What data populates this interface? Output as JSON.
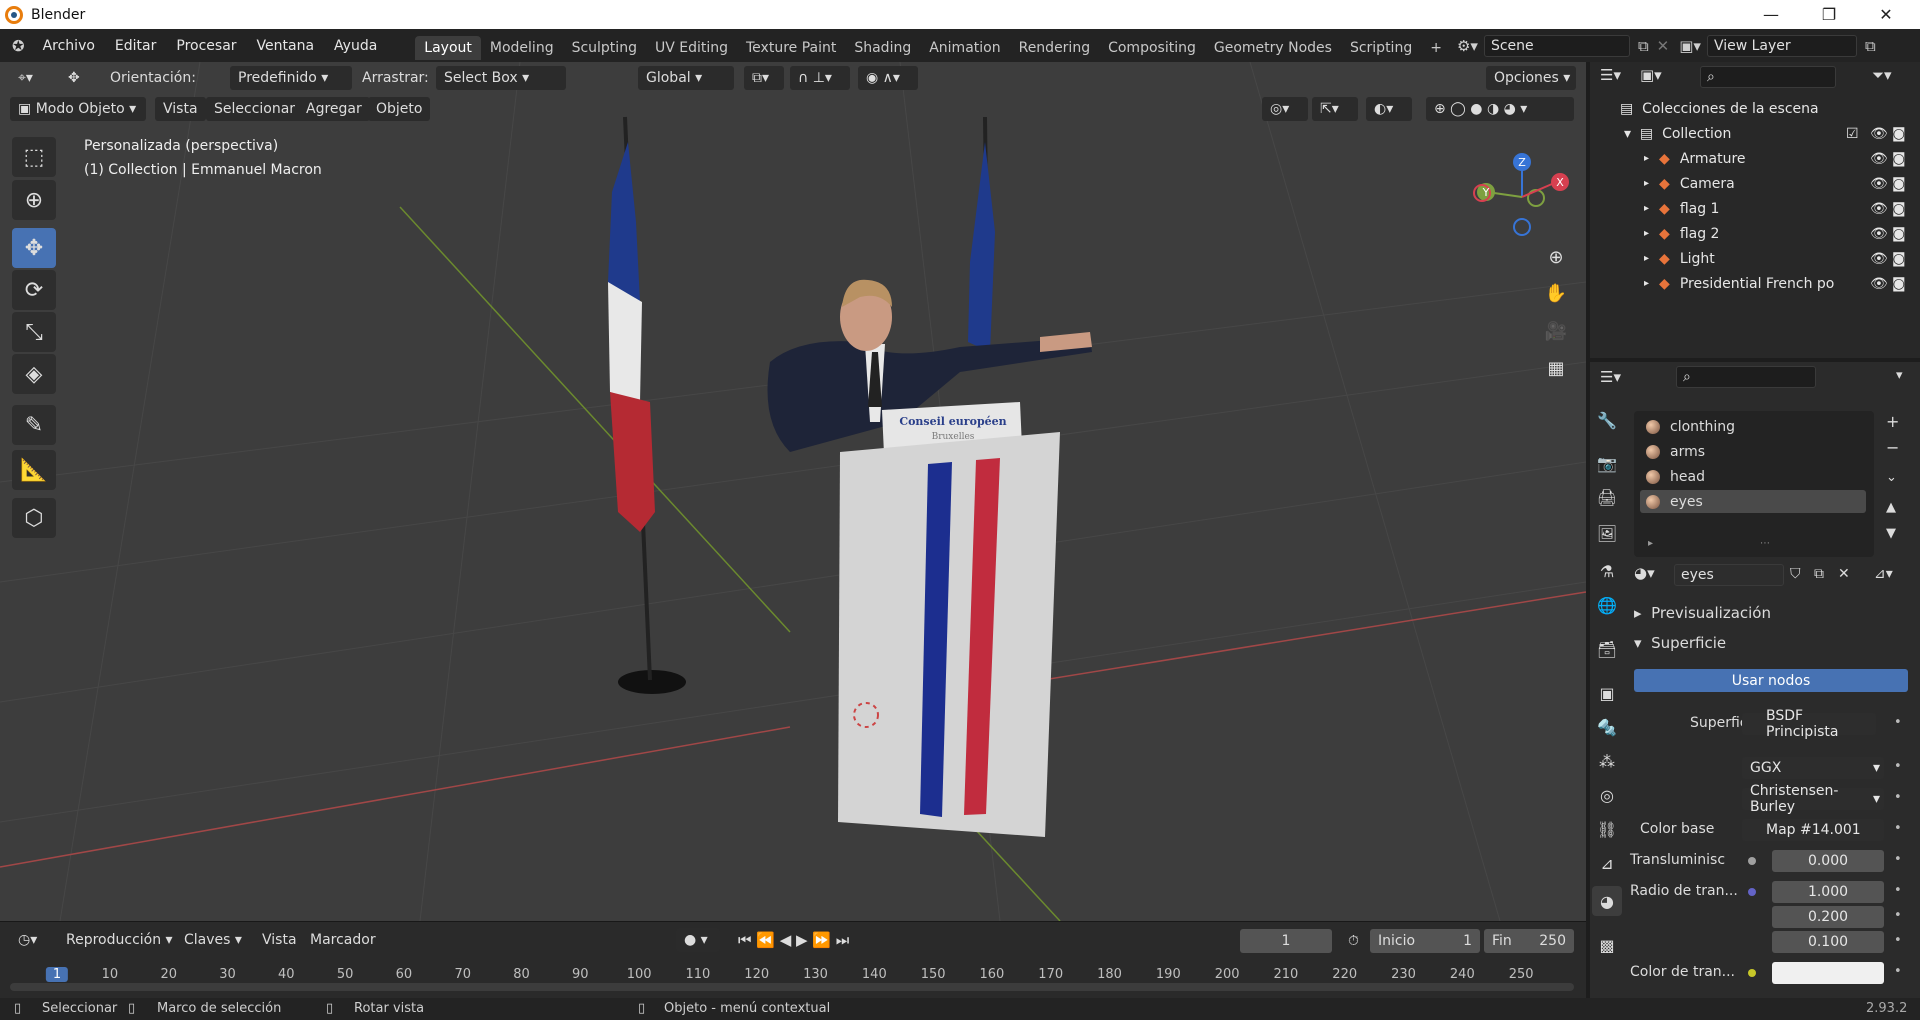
{
  "window": {
    "title": "Blender",
    "version": "2.93.2"
  },
  "menu": {
    "items": [
      "Archivo",
      "Editar",
      "Procesar",
      "Ventana",
      "Ayuda"
    ]
  },
  "workspaces": {
    "tabs": [
      "Layout",
      "Modeling",
      "Sculpting",
      "UV Editing",
      "Texture Paint",
      "Shading",
      "Animation",
      "Rendering",
      "Compositing",
      "Geometry Nodes",
      "Scripting"
    ],
    "active": "Layout"
  },
  "scene": {
    "name": "Scene",
    "view_layer": "View Layer"
  },
  "viewport_header": {
    "orientation_label": "Orientación:",
    "orientation_value": "Predefinido",
    "drag_label": "Arrastrar:",
    "drag_value": "Select Box",
    "transform_space": "Global",
    "options": "Opciones"
  },
  "viewport_menu": {
    "mode": "Modo Objeto",
    "items": [
      "Vista",
      "Seleccionar",
      "Agregar",
      "Objeto"
    ]
  },
  "viewport_info": {
    "view_name": "Personalizada (perspectiva)",
    "context": "(1) Collection | Emmanuel Macron"
  },
  "scene_content": {
    "lectern_title": "Conseil européen",
    "lectern_subtitle": "Bruxelles"
  },
  "gizmo": {
    "x": "X",
    "y": "Y",
    "z": "Z"
  },
  "outliner": {
    "header": "Colecciones de la escena",
    "collection": "Collection",
    "items": [
      {
        "name": "Armature",
        "icon": "armature-icon",
        "color": "#e8743b"
      },
      {
        "name": "Camera",
        "icon": "camera-icon",
        "color": "#e8743b"
      },
      {
        "name": "flag 1",
        "icon": "mesh-icon",
        "color": "#e8743b"
      },
      {
        "name": "flag 2",
        "icon": "mesh-icon",
        "color": "#e8743b"
      },
      {
        "name": "Light",
        "icon": "light-icon",
        "color": "#e8743b"
      },
      {
        "name": "Presidential French po",
        "icon": "mesh-icon",
        "color": "#e8743b"
      }
    ]
  },
  "material_slots": {
    "items": [
      "clonthing",
      "arms",
      "head",
      "eyes"
    ],
    "selected": "eyes",
    "current_material": "eyes"
  },
  "material_panel": {
    "preview_label": "Previsualización",
    "surface_label": "Superficie",
    "use_nodes": "Usar nodos",
    "fields": [
      {
        "label": "Superficie",
        "value": "BSDF Principista",
        "dot": "#4fbf4f"
      },
      {
        "label": "",
        "value": "GGX"
      },
      {
        "label": "",
        "value": "Christensen-Burley"
      },
      {
        "label": "Color base",
        "value": "Map #14.001",
        "dot": "#c7c729"
      },
      {
        "label": "Transluminisc",
        "value": "0.000",
        "dot": "#a0a0a0"
      },
      {
        "label": "Radio de tran...",
        "value": "1.000",
        "dot": "#6363c7"
      },
      {
        "label": "",
        "value": "0.200"
      },
      {
        "label": "",
        "value": "0.100"
      },
      {
        "label": "Color de tran...",
        "value": "",
        "dot": "#c7c729"
      }
    ]
  },
  "timeline": {
    "menus": [
      "Reproducción",
      "Claves",
      "Vista",
      "Marcador"
    ],
    "current_frame": "1",
    "start_label": "Inicio",
    "start": "1",
    "end_label": "Fin",
    "end": "250",
    "ticks": [
      "1",
      "10",
      "20",
      "30",
      "40",
      "50",
      "60",
      "70",
      "80",
      "90",
      "100",
      "110",
      "120",
      "130",
      "140",
      "150",
      "160",
      "170",
      "180",
      "190",
      "200",
      "210",
      "220",
      "230",
      "240",
      "250"
    ]
  },
  "status": {
    "select": "Seleccionar",
    "box_select": "Marco de selección",
    "rotate": "Rotar vista",
    "context_menu": "Objeto - menú contextual"
  }
}
